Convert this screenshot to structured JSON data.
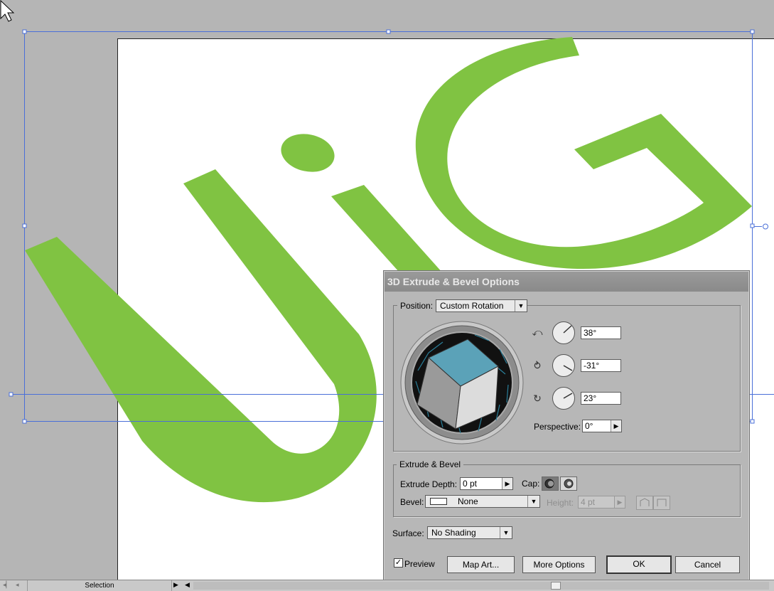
{
  "dialog": {
    "title": "3D Extrude & Bevel Options",
    "position_label": "Position:",
    "position_value": "Custom Rotation",
    "rotation_x": "38°",
    "rotation_y": "-31°",
    "rotation_z": "23°",
    "perspective_label": "Perspective:",
    "perspective_value": "0°",
    "extrude_group_label": "Extrude & Bevel",
    "extrude_depth_label": "Extrude Depth:",
    "extrude_depth_value": "0 pt",
    "cap_label": "Cap:",
    "bevel_label": "Bevel:",
    "bevel_value": "None",
    "height_label": "Height:",
    "height_value": "4 pt",
    "surface_label": "Surface:",
    "surface_value": "No Shading",
    "preview_label": "Preview",
    "preview_checked": "✓",
    "map_art_label": "Map Art...",
    "more_options_label": "More Options",
    "ok_label": "OK",
    "cancel_label": "Cancel"
  },
  "statusbar": {
    "tool": "Selection"
  },
  "colors": {
    "art_green": "#80c342",
    "selection_blue": "#4a6fd8",
    "cube_top": "#5ba2b8"
  }
}
